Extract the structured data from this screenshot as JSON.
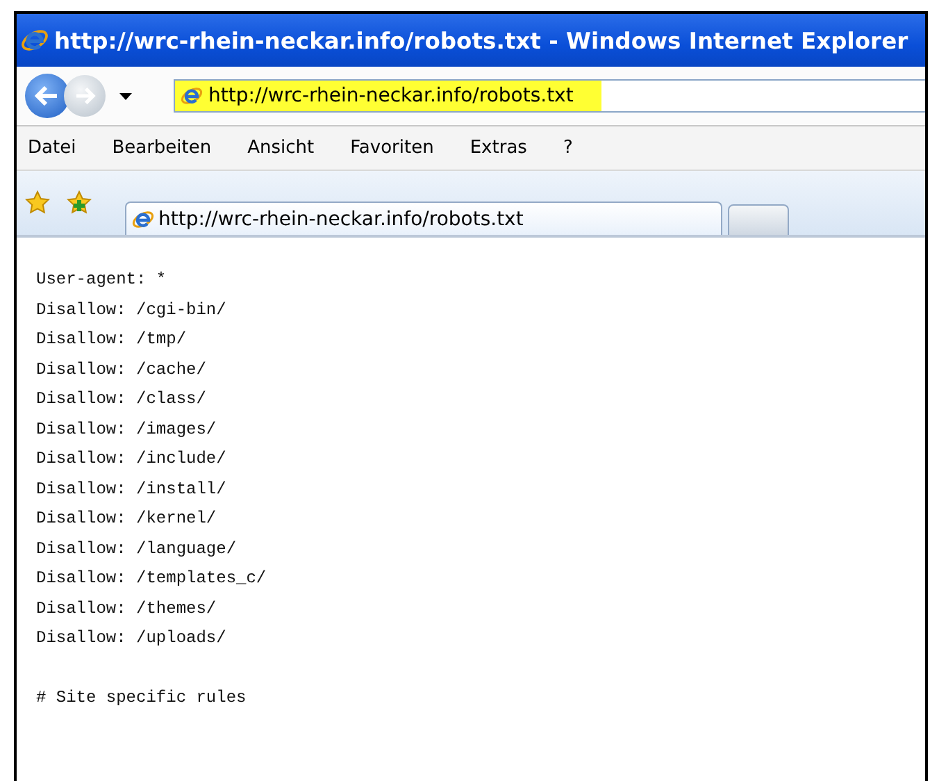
{
  "window": {
    "title": "http://wrc-rhein-neckar.info/robots.txt - Windows Internet Explorer"
  },
  "address_bar": {
    "value": "http://wrc-rhein-neckar.info/robots.txt"
  },
  "menu": [
    "Datei",
    "Bearbeiten",
    "Ansicht",
    "Favoriten",
    "Extras",
    "?"
  ],
  "tabs": [
    {
      "label": "http://wrc-rhein-neckar.info/robots.txt",
      "selected": true
    },
    {
      "selected": false
    }
  ],
  "content": {
    "blocks": [
      [
        "User-agent: *",
        "Disallow: /cgi-bin/",
        "Disallow: /tmp/",
        "Disallow: /cache/",
        "Disallow: /class/",
        "Disallow: /images/",
        "Disallow: /include/",
        "Disallow: /install/",
        "Disallow: /kernel/",
        "Disallow: /language/",
        "Disallow: /templates_c/",
        "Disallow: /themes/",
        "Disallow: /uploads/"
      ],
      [
        "# Site specific rules"
      ]
    ]
  }
}
